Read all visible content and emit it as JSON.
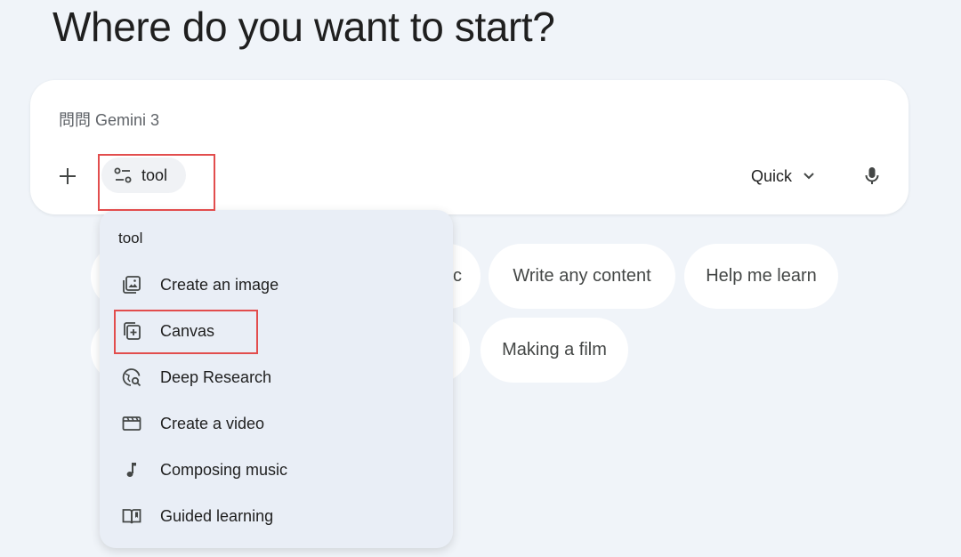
{
  "heading": "Where do you want to start?",
  "prompt": {
    "placeholder": "問問 Gemini 3",
    "tool_label": "tool",
    "mode_label": "Quick"
  },
  "chips": [
    {
      "label": "c"
    },
    {
      "label": "Write any content"
    },
    {
      "label": "Help me learn"
    },
    {
      "label": ""
    },
    {
      "label": "Making a film"
    }
  ],
  "tool_menu": {
    "header": "tool",
    "items": [
      {
        "label": "Create an image",
        "icon": "image-icon"
      },
      {
        "label": "Canvas",
        "icon": "canvas-icon"
      },
      {
        "label": "Deep Research",
        "icon": "deep-research-icon"
      },
      {
        "label": "Create a video",
        "icon": "video-icon"
      },
      {
        "label": "Composing music",
        "icon": "music-note-icon"
      },
      {
        "label": "Guided learning",
        "icon": "book-icon"
      }
    ]
  },
  "colors": {
    "background": "#f0f4f9",
    "highlight": "#e24d4d",
    "menu_background": "#e9eef6"
  }
}
